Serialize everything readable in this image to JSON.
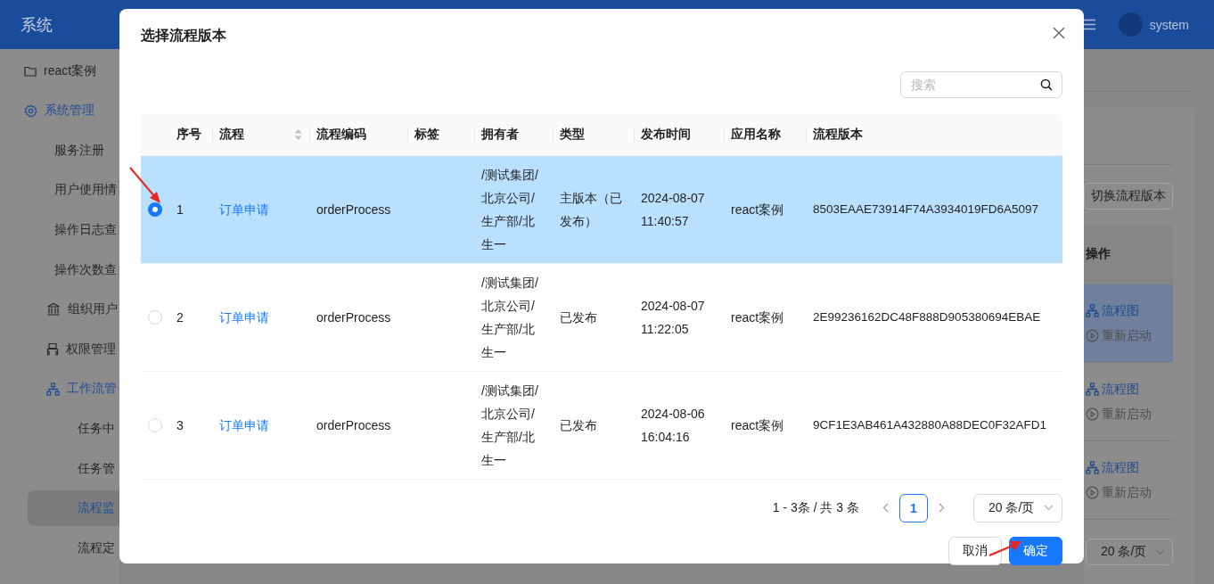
{
  "header": {
    "title": "系统",
    "user": "system"
  },
  "sidebar": {
    "items": [
      {
        "label": "react案例",
        "active": false,
        "selected": false
      },
      {
        "label": "系统管理",
        "active": true,
        "selected": false,
        "children": [
          {
            "label": "服务注册",
            "active": false,
            "selected": false
          },
          {
            "label": "用户使用情",
            "active": false,
            "selected": false
          },
          {
            "label": "操作日志查",
            "active": false,
            "selected": false
          },
          {
            "label": "操作次数查",
            "active": false,
            "selected": false
          },
          {
            "label": "组织用户",
            "active": false,
            "selected": false
          },
          {
            "label": "权限管理",
            "active": false,
            "selected": false
          },
          {
            "label": "工作流管",
            "active": true,
            "selected": false,
            "children": [
              {
                "label": "任务中",
                "active": false,
                "selected": false
              },
              {
                "label": "任务管",
                "active": false,
                "selected": false
              },
              {
                "label": "流程监",
                "active": false,
                "selected": true
              },
              {
                "label": "流程定",
                "active": false,
                "selected": false
              }
            ]
          }
        ]
      }
    ]
  },
  "background": {
    "switch_button": "切换流程版本",
    "table": {
      "column": "操作",
      "rows": [
        {
          "selected": true,
          "actions": [
            {
              "label": "流程图",
              "disabled": false
            },
            {
              "label": "重新启动",
              "disabled": true
            }
          ]
        },
        {
          "selected": false,
          "actions": [
            {
              "label": "流程图",
              "disabled": false
            },
            {
              "label": "重新启动",
              "disabled": true
            }
          ]
        },
        {
          "selected": false,
          "actions": [
            {
              "label": "流程图",
              "disabled": false
            },
            {
              "label": "重新启动",
              "disabled": true
            }
          ]
        }
      ]
    },
    "page_size": "20 条/页"
  },
  "dialog": {
    "title": "选择流程版本",
    "search": {
      "placeholder": "搜索"
    },
    "table": {
      "columns": [
        {
          "label": "序号",
          "sortable": false
        },
        {
          "label": "流程",
          "sortable": true
        },
        {
          "label": "流程编码",
          "sortable": false
        },
        {
          "label": "标签",
          "sortable": false
        },
        {
          "label": "拥有者",
          "sortable": false
        },
        {
          "label": "类型",
          "sortable": false
        },
        {
          "label": "发布时间",
          "sortable": false
        },
        {
          "label": "应用名称",
          "sortable": false
        },
        {
          "label": "流程版本",
          "sortable": false
        }
      ],
      "rows": [
        {
          "selected": true,
          "index": "1",
          "process": "订单申请",
          "code": "orderProcess",
          "owner": "/测试集团/北京公司/生产部/北生一",
          "type": "主版本（已发布）",
          "published": "2024-08-07 11:40:57",
          "app": "react案例",
          "version": "8503EAAE73914F74A3934019FD6A5097"
        },
        {
          "selected": false,
          "index": "2",
          "process": "订单申请",
          "code": "orderProcess",
          "owner": "/测试集团/北京公司/生产部/北生一",
          "type": "已发布",
          "published": "2024-08-07 11:22:05",
          "app": "react案例",
          "version": "2E99236162DC48F888D905380694EBAE"
        },
        {
          "selected": false,
          "index": "3",
          "process": "订单申请",
          "code": "orderProcess",
          "owner": "/测试集团/北京公司/生产部/北生一",
          "type": "已发布",
          "published": "2024-08-06 16:04:16",
          "app": "react案例",
          "version": "9CF1E3AB461A432880A88DEC0F32AFD1"
        }
      ]
    },
    "pagination": {
      "summary": "1 - 3条 / 共 3 条",
      "prev_disabled": true,
      "pages": [
        {
          "label": "1",
          "selected": true
        }
      ],
      "next_disabled": true,
      "page_size": "20 条/页"
    },
    "buttons": [
      {
        "label": "取消",
        "kind": "default"
      },
      {
        "label": "确定",
        "kind": "primary"
      }
    ]
  }
}
